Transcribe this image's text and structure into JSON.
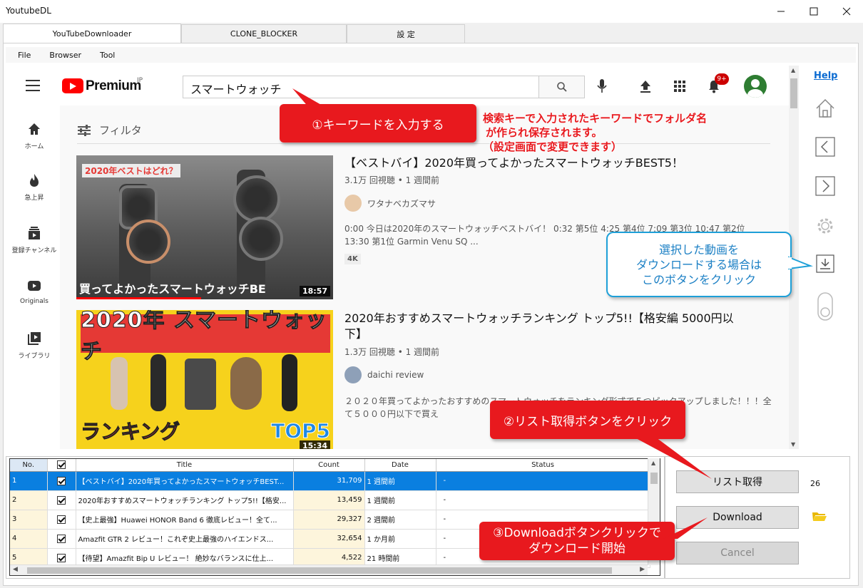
{
  "window": {
    "title": "YoutubeDL"
  },
  "tabs": [
    "YouTubeDownloader",
    "CLONE_BLOCKER",
    "設 定"
  ],
  "menu": [
    "File",
    "Browser",
    "Tool"
  ],
  "youtube": {
    "logo": "Premium",
    "logo_sup": "JP",
    "search_value": "スマートウォッチ",
    "notif_badge": "9+",
    "nav": [
      "ホーム",
      "急上昇",
      "登録チャンネル",
      "Originals",
      "ライブラリ"
    ],
    "filter": "フィルタ",
    "videos": [
      {
        "title": "【ベストバイ】2020年買ってよかったスマートウォッチBEST5！",
        "meta": "3.1万 回視聴 • 1 週間前",
        "channel": "ワタナベカズマサ",
        "desc": "0:00 今日は2020年のスマートウォッチベストバイ！ 0:32 第5位 4:25 第4位 7:09 第3位 10:47 第2位 13:30 第1位 Garmin Venu SQ ...",
        "tag": "4K",
        "thumb_tag": "2020年ベストはどれ？",
        "thumb_caption": "買ってよかったスマートウォッチBE",
        "duration": "18:57"
      },
      {
        "title": "2020年おすすめスマートウォッチランキング トップ5!!【格安編 5000円以下】",
        "meta": "1.3万 回視聴 • 1 週間前",
        "channel": "daichi review",
        "desc": "２０２０年買ってよかったおすすめのスマートウォッチをランキング形式で５つピックアップしました！！！全て５０００円以下で買え",
        "thumb_top": "2020年 スマートウォッチ",
        "thumb_rank": "ランキング",
        "thumb_top5": "TOP5",
        "duration": "15:34"
      }
    ]
  },
  "right_toolbar": {
    "help": "Help"
  },
  "callouts": {
    "step1": "①キーワードを入力する",
    "note1": [
      "検索キーで入力されたキーワードでフォルダ名",
      "が作られ保存されます。",
      "（設定画面で変更できます）"
    ],
    "blue": [
      "選択した動画を",
      "ダウンロードする場合は",
      "このボタンをクリック"
    ],
    "step2": "②リスト取得ボタンをクリック",
    "step3": [
      "③Downloadボタンクリックで",
      "ダウンロード開始"
    ]
  },
  "grid": {
    "headers": [
      "No.",
      "",
      "Title",
      "Count",
      "Date",
      "Status"
    ],
    "rows": [
      {
        "no": "1",
        "title": "【ベストバイ】2020年買ってよかったスマートウォッチBEST...",
        "count": "31,709",
        "date": "1 週間前",
        "status": "-"
      },
      {
        "no": "2",
        "title": "2020年おすすめスマートウォッチランキング トップ5!!【格安...",
        "count": "13,459",
        "date": "1 週間前",
        "status": "-"
      },
      {
        "no": "3",
        "title": "【史上最強】Huawei HONOR Band 6 徹底レビュー！全て...",
        "count": "29,327",
        "date": "2 週間前",
        "status": "-"
      },
      {
        "no": "4",
        "title": "Amazfit GTR 2 レビュー！これぞ史上最強のハイエンドス...",
        "count": "32,654",
        "date": "1 か月前",
        "status": "-"
      },
      {
        "no": "5",
        "title": "【待望】Amazfit Bip U レビュー！ 絶妙なバランスに仕上...",
        "count": "4,522",
        "date": "21 時間前",
        "status": "-"
      }
    ]
  },
  "buttons": {
    "list": "リスト取得",
    "download": "Download",
    "cancel": "Cancel"
  },
  "list_count": "26"
}
